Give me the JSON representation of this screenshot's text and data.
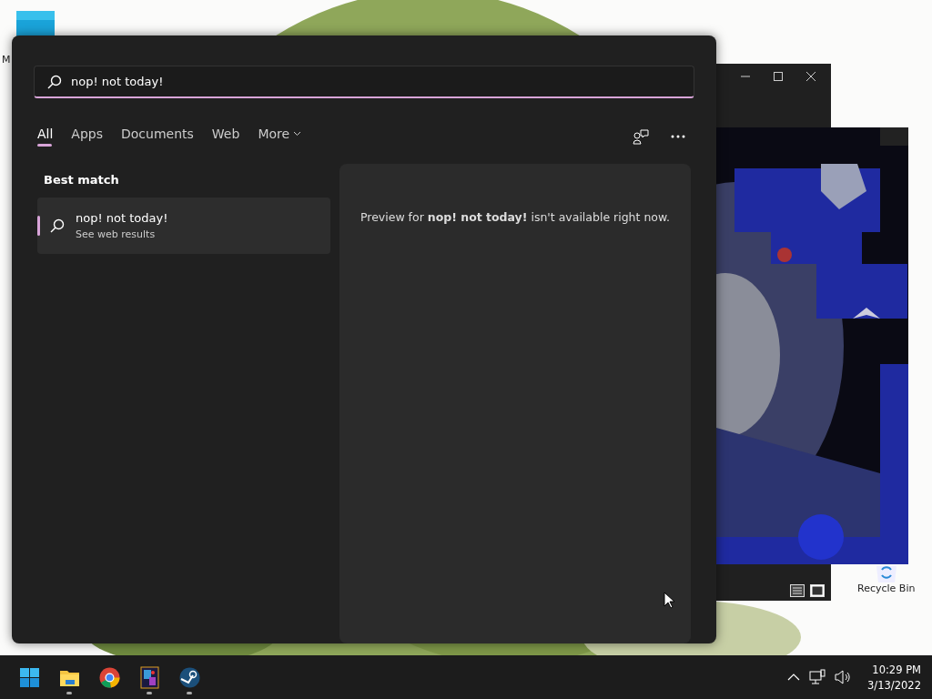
{
  "desktop": {
    "icons": [
      {
        "kind": "app",
        "label": "M"
      },
      {
        "kind": "recycle",
        "label": "Recycle Bin"
      }
    ]
  },
  "background_window": {
    "kind": "game"
  },
  "search": {
    "query": "nop! not today!",
    "tabs": [
      {
        "label": "All",
        "selected": true,
        "kind": "plain"
      },
      {
        "label": "Apps",
        "selected": false,
        "kind": "plain"
      },
      {
        "label": "Documents",
        "selected": false,
        "kind": "plain"
      },
      {
        "label": "Web",
        "selected": false,
        "kind": "plain"
      },
      {
        "label": "More",
        "selected": false,
        "kind": "dropdown"
      }
    ],
    "section_title": "Best match",
    "result": {
      "title": "nop! not today!",
      "subtitle": "See web results",
      "selected": true
    },
    "preview_text": "Preview for **nop! not today!** isn't available right now."
  },
  "taskbar": {
    "apps": [
      {
        "kind": "start",
        "running": false
      },
      {
        "kind": "folder",
        "running": true
      },
      {
        "kind": "browser",
        "running": false
      },
      {
        "kind": "game",
        "running": true
      },
      {
        "kind": "steam",
        "running": true
      }
    ],
    "time": "10:29 PM",
    "date": "3/13/2022"
  }
}
